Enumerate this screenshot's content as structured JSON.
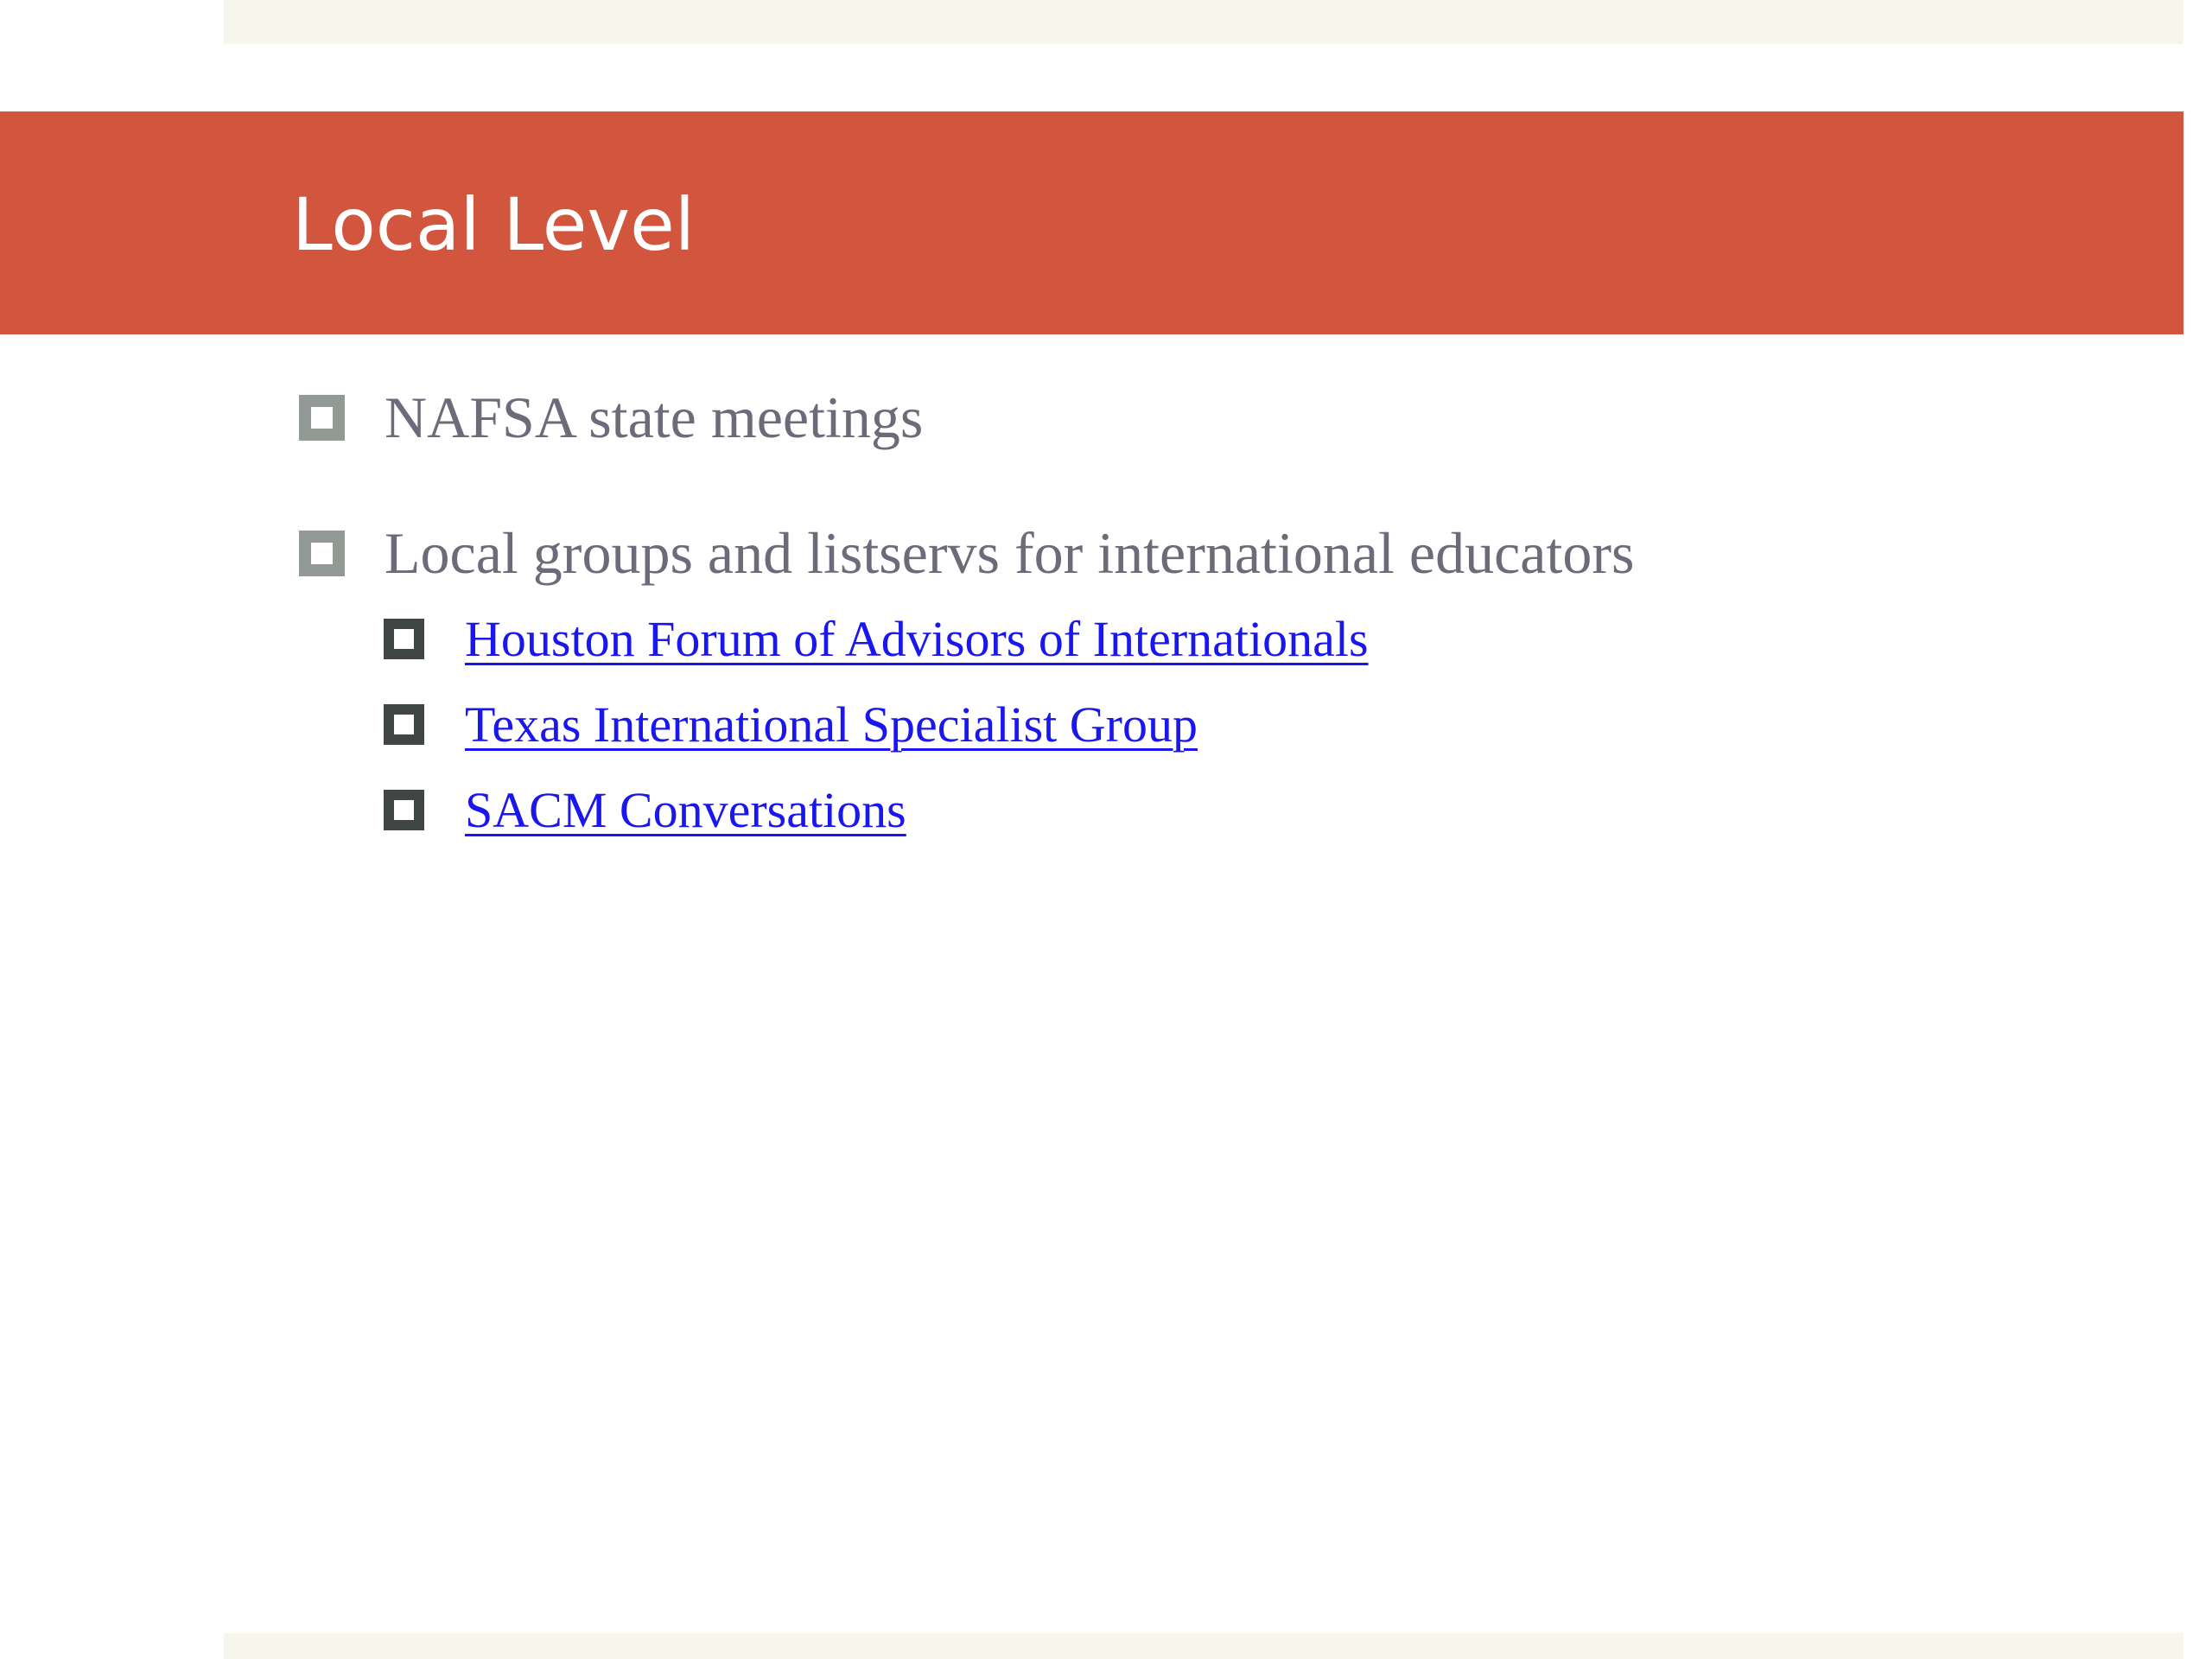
{
  "slide": {
    "title": "Local Level",
    "bullets": [
      {
        "text": "NAFSA state meetings"
      },
      {
        "text": "Local groups and listservs for international educators",
        "sub_items": [
          {
            "text": "Houston Forum of  Advisors of  Internationals"
          },
          {
            "text": "Texas International Specialist Group"
          },
          {
            "text": "SACM Conversations"
          }
        ]
      }
    ]
  },
  "colors": {
    "title_bar": "#d2553e",
    "band": "#f6f6ec",
    "body_text": "#6b6b79",
    "link": "#1a16ee",
    "bullet_level1": "#939a96",
    "bullet_level2": "#3f4643"
  },
  "icons": {
    "level1_bullet": "hollow-square-icon",
    "level2_bullet": "hollow-square-icon"
  }
}
